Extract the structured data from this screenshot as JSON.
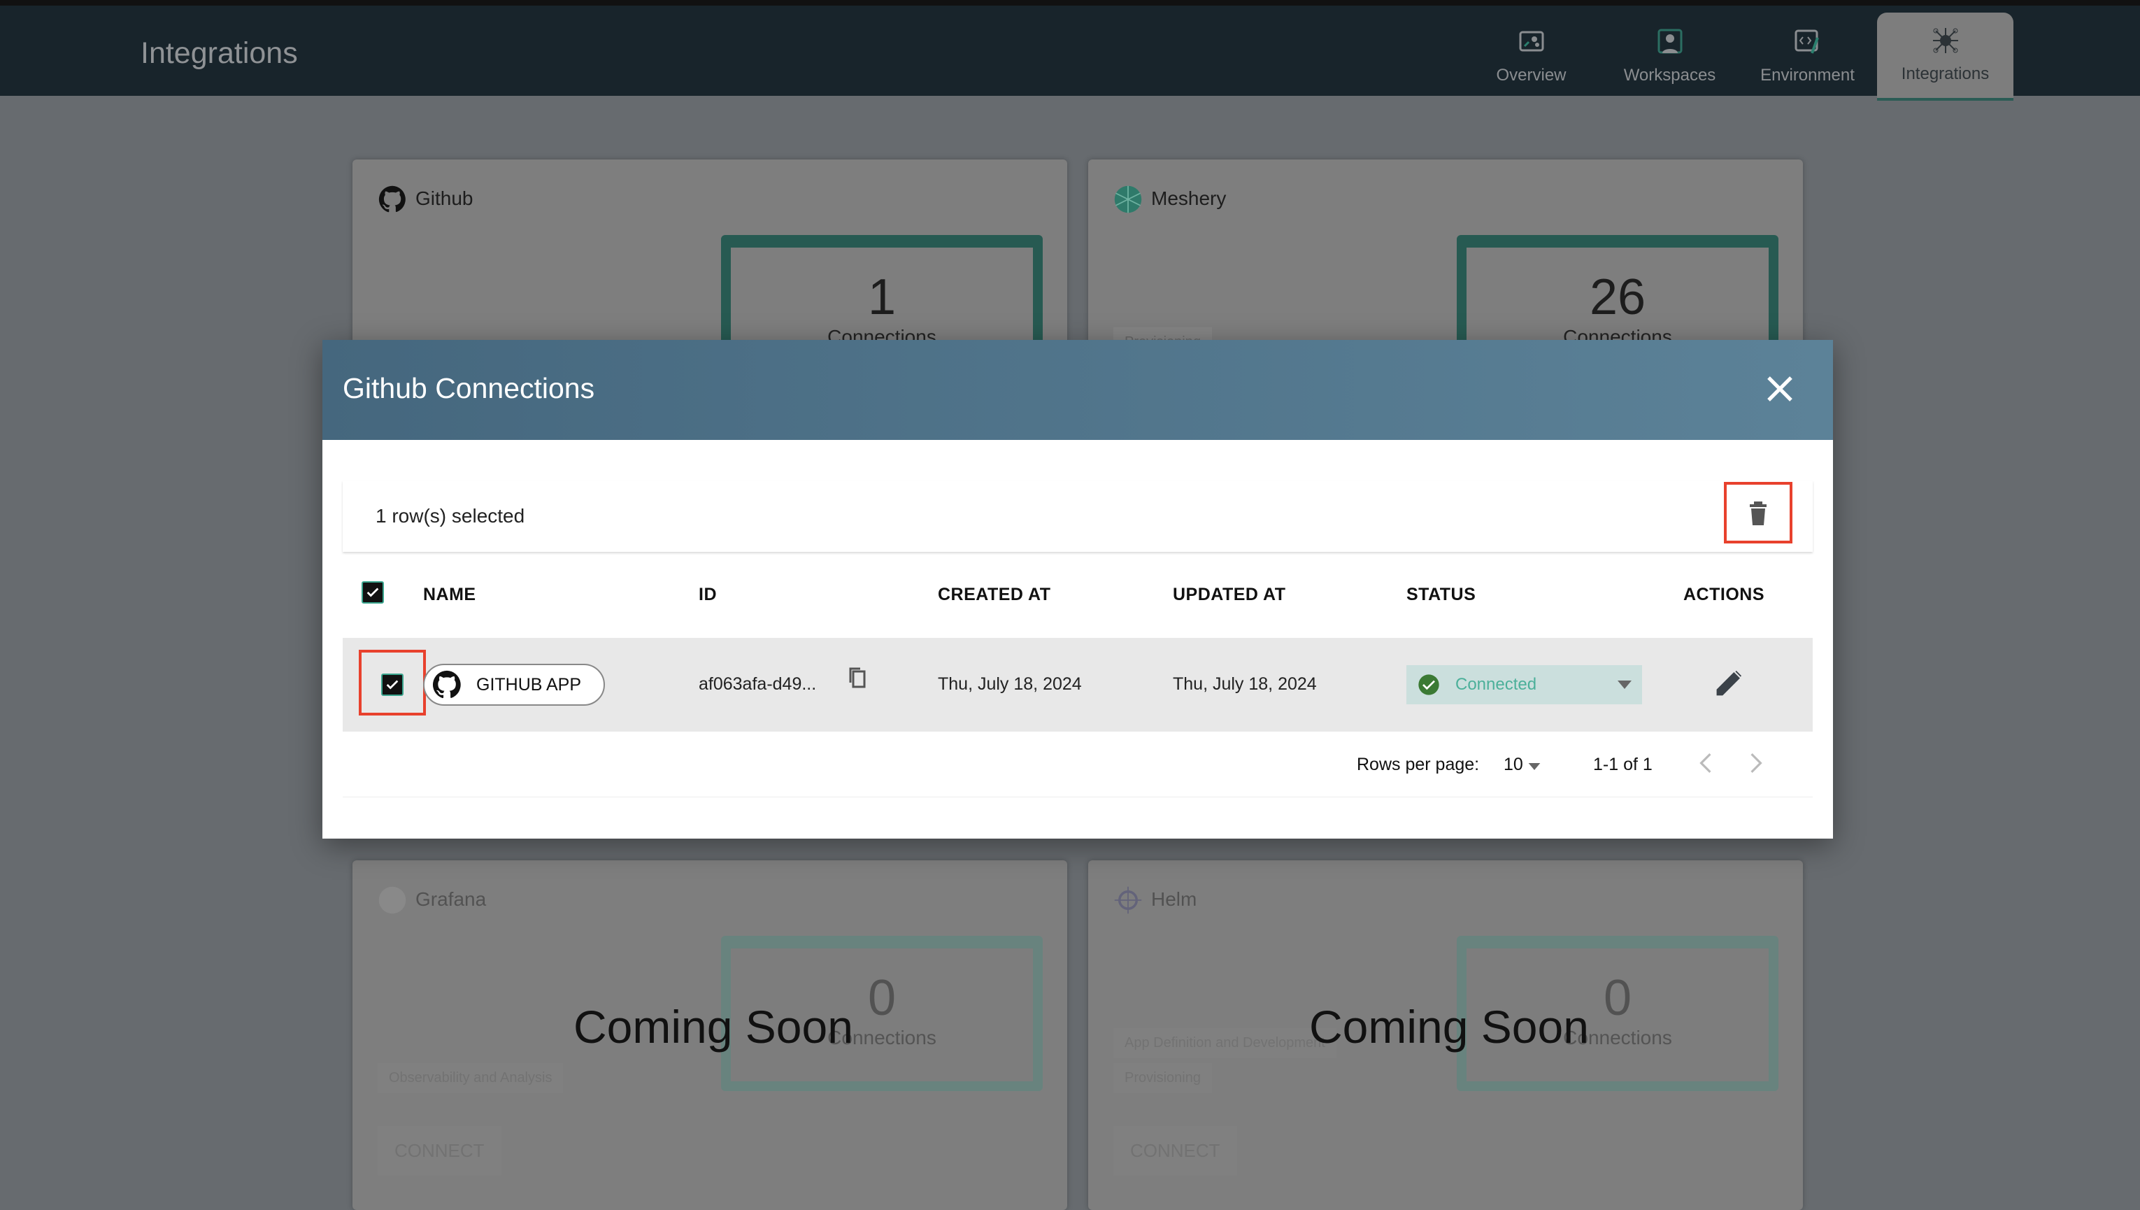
{
  "header": {
    "title": "Integrations",
    "nav": [
      {
        "label": "Overview",
        "icon": "overview-icon"
      },
      {
        "label": "Workspaces",
        "icon": "workspaces-icon"
      },
      {
        "label": "Environment",
        "icon": "environment-icon"
      },
      {
        "label": "Integrations",
        "icon": "integrations-icon",
        "active": true
      }
    ]
  },
  "cards": [
    {
      "name": "Github",
      "count": "1",
      "count_label": "Connections"
    },
    {
      "name": "Meshery",
      "count": "26",
      "count_label": "Connections",
      "tags": [
        "Provisioning"
      ]
    },
    {
      "name": "Grafana",
      "count": "0",
      "count_label": "Connections",
      "tags": [
        "Observability and Analysis"
      ],
      "connect": "CONNECT",
      "overlay": "Coming Soon"
    },
    {
      "name": "Helm",
      "count": "0",
      "count_label": "Connections",
      "tags": [
        "App Definition and Development",
        "Provisioning"
      ],
      "connect": "CONNECT",
      "overlay": "Coming Soon"
    }
  ],
  "modal": {
    "title": "Github Connections",
    "selected_text": "1 row(s) selected",
    "columns": [
      "NAME",
      "ID",
      "CREATED AT",
      "UPDATED AT",
      "STATUS",
      "ACTIONS"
    ],
    "rows": [
      {
        "name": "GITHUB APP",
        "id": "af063afa-d49...",
        "created_at": "Thu, July 18, 2024",
        "updated_at": "Thu, July 18, 2024",
        "status": "Connected",
        "selected": true
      }
    ],
    "pagination": {
      "rows_per_page_label": "Rows per page:",
      "rows_per_page": "10",
      "range": "1-1 of 1"
    }
  },
  "colors": {
    "header_bg": "#18242b",
    "modal_header": "#4f7489",
    "accent": "#275a52",
    "highlight": "#e8412d",
    "status_ok": "#3b7a34"
  }
}
